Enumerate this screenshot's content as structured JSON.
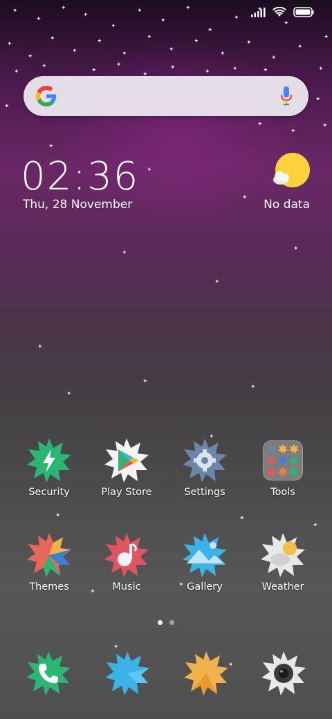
{
  "status_bar": {
    "icons": [
      "signal-icon",
      "wifi-icon",
      "battery-icon"
    ]
  },
  "search": {
    "logo": "google-g-logo",
    "mic": "microphone-icon"
  },
  "clock_widget": {
    "time": "02:36",
    "date": "Thu, 28 November"
  },
  "weather_widget": {
    "icon": "sun-cloud-icon",
    "label": "No data"
  },
  "apps": [
    {
      "label": "Security",
      "icon": "security-icon",
      "color": "#2bb673"
    },
    {
      "label": "Play Store",
      "icon": "play-store-icon",
      "color": "#ffffff"
    },
    {
      "label": "Settings",
      "icon": "settings-gear-icon",
      "color": "#6b86a8"
    },
    {
      "label": "Tools",
      "icon": "folder-icon",
      "color": "#bdbdbd"
    },
    {
      "label": "Themes",
      "icon": "themes-icon",
      "color": "#e8665a"
    },
    {
      "label": "Music",
      "icon": "music-icon",
      "color": "#e05561"
    },
    {
      "label": "Gallery",
      "icon": "gallery-icon",
      "color": "#3bb3e6"
    },
    {
      "label": "Weather",
      "icon": "weather-icon",
      "color": "#e8e8e8"
    }
  ],
  "page_indicator": {
    "current": 1,
    "total": 2
  },
  "dock": [
    {
      "icon": "phone-icon",
      "color": "#2bb673"
    },
    {
      "icon": "messaging-icon",
      "color": "#3bb3e6"
    },
    {
      "icon": "browser-icon",
      "color": "#f0b24d"
    },
    {
      "icon": "camera-icon",
      "color": "#e8e8e8"
    }
  ]
}
